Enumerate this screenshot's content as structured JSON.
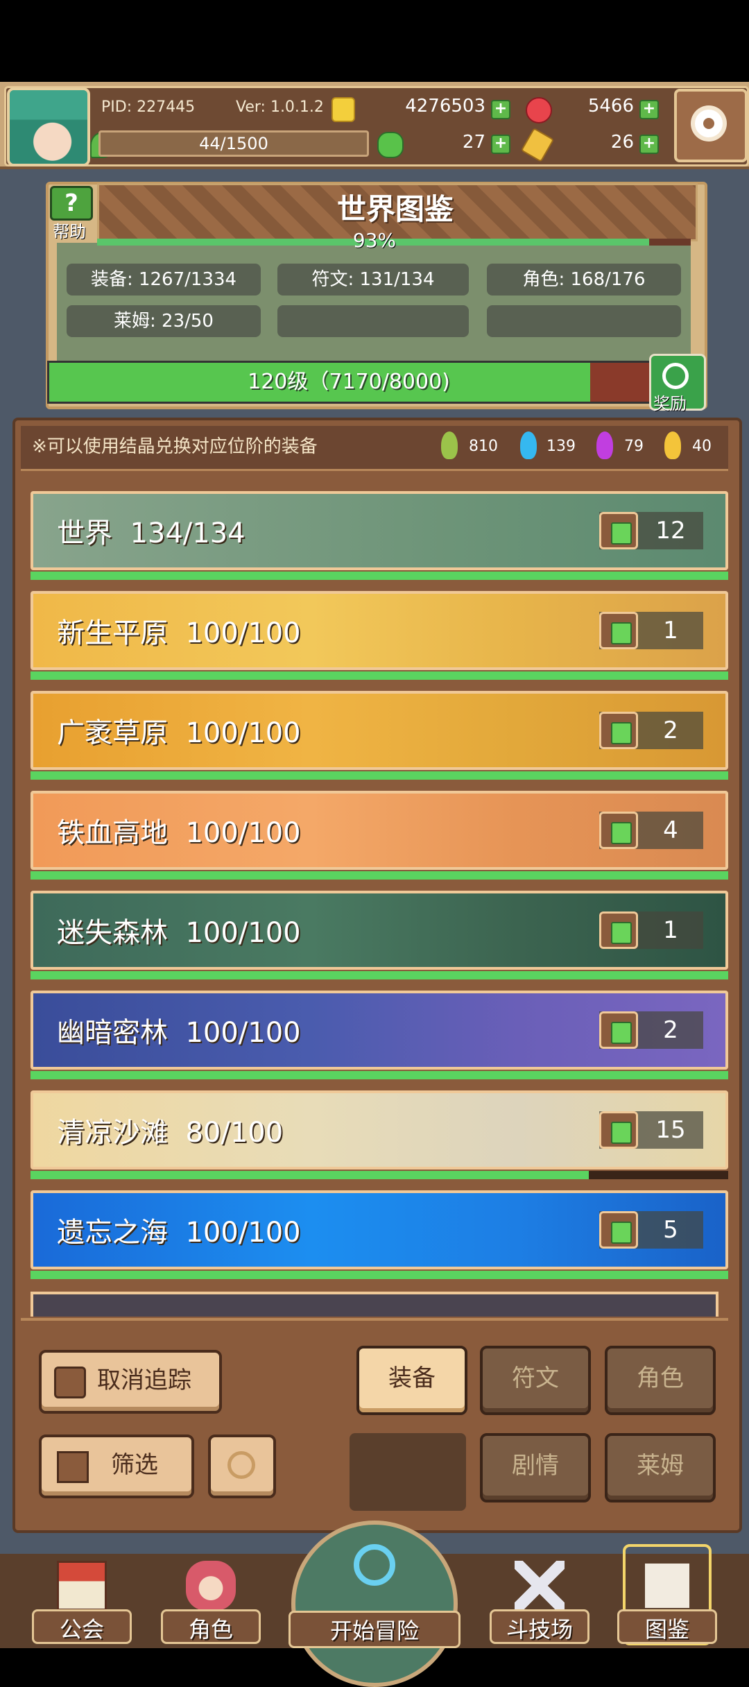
{
  "header": {
    "pid": "PID: 227445",
    "version": "Ver: 1.0.1.2",
    "gold": "4276503",
    "ruby": "5466",
    "stamina": "44/1500",
    "clover": "27",
    "key": "26"
  },
  "collection": {
    "title": "世界图鉴",
    "help_label": "帮助",
    "percent": "93%",
    "percent_value": 0.93,
    "stats": {
      "equipment": "装备: 1267/1334",
      "rune": "符文: 131/134",
      "character": "角色: 168/176",
      "slime": "莱姆: 23/50"
    },
    "level_text": "120级（7170/8000)",
    "level_progress": 0.896,
    "reward_label": "奖励"
  },
  "panel": {
    "notice": "※可以使用结晶兑换对应位阶的装备",
    "crystals": [
      {
        "value": "810",
        "color": "#9bc34a"
      },
      {
        "value": "139",
        "color": "#35b8f0"
      },
      {
        "value": "79",
        "color": "#c13ee0"
      },
      {
        "value": "40",
        "color": "#f3c43a"
      }
    ]
  },
  "regions": [
    {
      "name": "世界",
      "count": "134/134",
      "likes": "12",
      "progress": 1.0,
      "bg": "linear-gradient(90deg,#88a48c,#6d9478 60%,#5c8a70)"
    },
    {
      "name": "新生平原",
      "count": "100/100",
      "likes": "1",
      "progress": 1.0,
      "bg": "linear-gradient(90deg,#f0b848,#f2c85a 40%,#e7b44a 70%,#dba24a)"
    },
    {
      "name": "广袤草原",
      "count": "100/100",
      "likes": "2",
      "progress": 1.0,
      "bg": "linear-gradient(90deg,#e8a030,#f0b444 40%,#e2a83a 70%,#d89834)"
    },
    {
      "name": "铁血高地",
      "count": "100/100",
      "likes": "4",
      "progress": 1.0,
      "bg": "linear-gradient(90deg,#f19a58,#f4a868 40%,#e69456 70%,#d98a52)"
    },
    {
      "name": "迷失森林",
      "count": "100/100",
      "likes": "1",
      "progress": 1.0,
      "bg": "linear-gradient(90deg,#3e6a5a,#4a7a62 40%,#3c6450 70%,#2e5444)"
    },
    {
      "name": "幽暗密林",
      "count": "100/100",
      "likes": "2",
      "progress": 1.0,
      "bg": "linear-gradient(90deg,#3a4d9a,#4a5cae 40%,#6a5fb8 70%,#7a66c0)"
    },
    {
      "name": "清凉沙滩",
      "count": "80/100",
      "likes": "15",
      "progress": 0.8,
      "bg": "linear-gradient(90deg,#efd7a0,#e8dcb8 40%,#ddd4bc 70%,#e6d6a8)"
    },
    {
      "name": "遗忘之海",
      "count": "100/100",
      "likes": "5",
      "progress": 1.0,
      "bg": "linear-gradient(90deg,#1a6ad8,#1c8ef0 40%,#1d7ee4 70%,#1a62c8)"
    }
  ],
  "filters": {
    "untrack": "取消追踪",
    "filter": "筛选",
    "equipment": "装备",
    "rune": "符文",
    "character": "角色",
    "story": "剧情",
    "slime": "莱姆"
  },
  "nav": {
    "guild": "公会",
    "character": "角色",
    "adventure": "开始冒险",
    "arena": "斗技场",
    "codex": "图鉴"
  },
  "colors": {
    "accent_green": "#5ad460",
    "panel_brown": "#8a5b3c",
    "border_tan": "#e5c795"
  }
}
